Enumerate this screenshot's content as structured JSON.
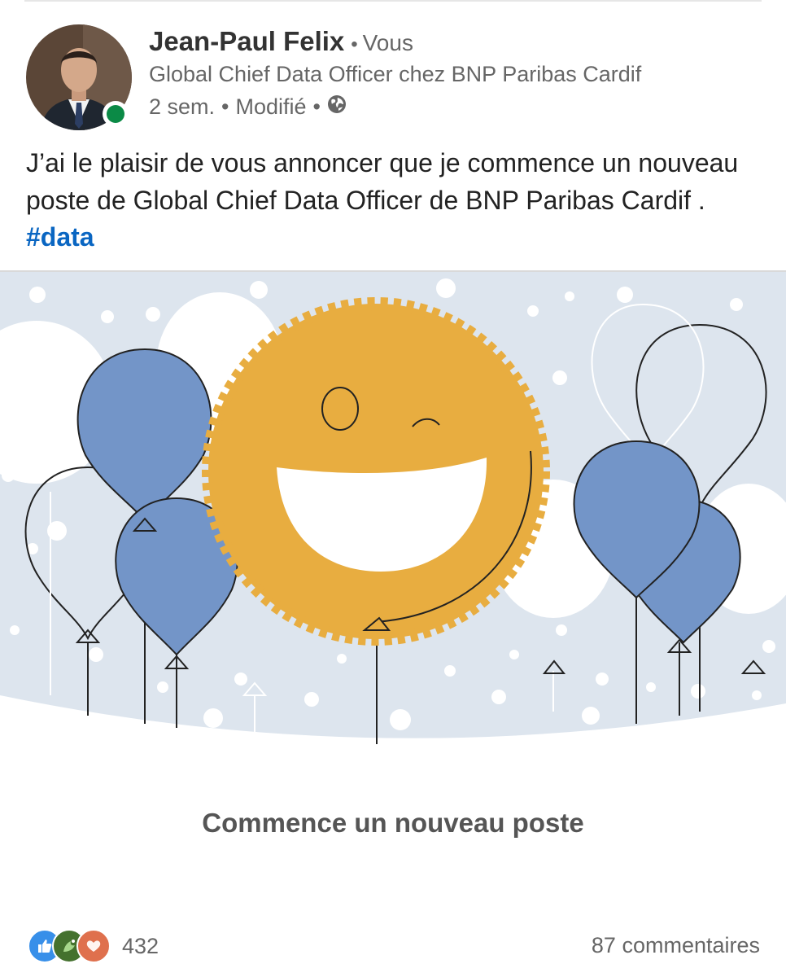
{
  "post": {
    "author": {
      "name": "Jean-Paul Felix",
      "relation": "Vous",
      "headline": "Global Chief Data Officer chez BNP Paribas Cardif",
      "time": "2 sem.",
      "edited": "Modifié",
      "visibility_icon": "globe-icon",
      "online_status_color": "#0b8a46"
    },
    "text": "J’ai le plaisir de vous annoncer que je commence un nouveau poste de Global Chief Data Officer de BNP Paribas Cardif .",
    "hashtag": "#data",
    "media": {
      "illustration": "smiley-sun-balloons-illustration",
      "caption": "Commence un nouveau poste",
      "colors": {
        "background": "#dde5ee",
        "sun": "#e8ad40",
        "balloon_blue": "#7395c8",
        "balloon_white": "#ffffff"
      }
    },
    "social": {
      "reaction_icons": [
        "like-icon",
        "celebrate-icon",
        "love-icon"
      ],
      "reaction_count": "432",
      "comments": "87 commentaires"
    }
  }
}
